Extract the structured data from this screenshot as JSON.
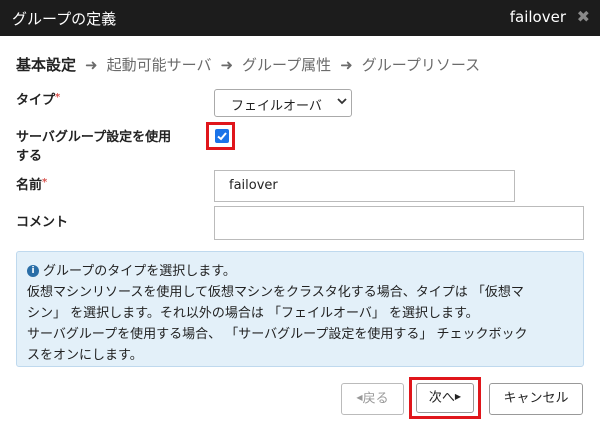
{
  "window": {
    "title": "グループの定義",
    "group_name": "failover",
    "close_glyph": "✖"
  },
  "steps": [
    {
      "label": "基本設定",
      "active": true
    },
    {
      "label": "起動可能サーバ",
      "active": false
    },
    {
      "label": "グループ属性",
      "active": false
    },
    {
      "label": "グループリソース",
      "active": false
    }
  ],
  "step_arrow": "➜",
  "form": {
    "type_label": "タイプ",
    "type_value": "フェイルオーバ",
    "required_mark": "*",
    "servergroup_label_line1": "サーバグループ設定を使用",
    "servergroup_label_line2": "する",
    "servergroup_checked": true,
    "name_label": "名前",
    "name_value": "failover",
    "comment_label": "コメント",
    "comment_value": ""
  },
  "info": {
    "icon_glyph": "i",
    "line1": "グループのタイプを選択します。",
    "line2": "仮想マシンリソースを使用して仮想マシンをクラスタ化する場合、タイプは 「仮想マ",
    "line3": "シン」 を選択します。それ以外の場合は 「フェイルオーバ」 を選択します。",
    "line4": "サーバグループを使用する場合、 「サーバグループ設定を使用する」 チェックボック",
    "line5": "スをオンにします。"
  },
  "buttons": {
    "back": "戻る",
    "next": "次へ",
    "cancel": "キャンセル"
  },
  "colors": {
    "titlebar_bg": "#1c1c1c",
    "highlight": "#e0161b",
    "info_bg": "#e3f0f9",
    "checkbox": "#1a73e8"
  }
}
